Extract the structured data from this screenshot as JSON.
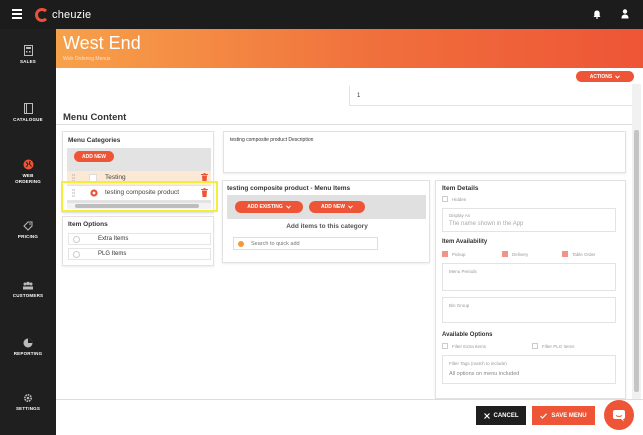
{
  "app": {
    "brand": "cheuzie"
  },
  "sidebar": {
    "items": [
      {
        "label": "SALES",
        "icon": "calculator-icon"
      },
      {
        "label": "CATALOGUE",
        "icon": "book-icon"
      },
      {
        "label": "WEB ORDERING",
        "icon": "globe-icon",
        "active": true
      },
      {
        "label": "PRICING",
        "icon": "tag-icon"
      },
      {
        "label": "CUSTOMERS",
        "icon": "people-icon"
      },
      {
        "label": "REPORTING",
        "icon": "pie-chart-icon"
      },
      {
        "label": "SETTINGS",
        "icon": "gear-icon"
      }
    ]
  },
  "header": {
    "title": "West End",
    "subtitle": "Web Ordering Menus"
  },
  "actions": {
    "label": "ACTIONS"
  },
  "top_field": {
    "value": "1"
  },
  "menu_content": {
    "title": "Menu Content"
  },
  "categories": {
    "title": "Menu Categories",
    "add_label": "ADD NEW",
    "rows": [
      {
        "label": "Testing"
      },
      {
        "label": "testing composite product"
      }
    ]
  },
  "description": {
    "text": "testing composite product Description"
  },
  "item_options": {
    "title": "Item Options",
    "rows": [
      {
        "label": "Extra Items"
      },
      {
        "label": "PLG Items"
      }
    ]
  },
  "menu_items": {
    "title": "testing composite product - Menu Items",
    "add_existing_label": "ADD EXISTING",
    "add_new_label": "ADD NEW",
    "empty_text": "Add items to this category",
    "search_placeholder": "Search to quick add"
  },
  "item_details": {
    "title": "Item Details",
    "hidden_label": "Hidden",
    "display_as_label": "Display As",
    "display_as_placeholder": "The name shown in the App",
    "availability_title": "Item Availability",
    "pickup_label": "Pickup",
    "delivery_label": "Delivery",
    "table_order_label": "Table Order",
    "menu_periods_label": "Menu Periods",
    "bin_group_label": "Bin Group",
    "available_options_title": "Available Options",
    "filter_extra_label": "Filter Extra Items",
    "filter_plg_label": "Filter PLG Items",
    "filter_tags_label": "Filter Tags (match to include)",
    "filter_tags_value": "All options on menu included"
  },
  "footer": {
    "cancel_label": "CANCEL",
    "save_label": "SAVE MENU"
  },
  "colors": {
    "accent": "#ee5536",
    "highlight": "#f2ee3a",
    "sidebar": "#1f1f1f"
  }
}
